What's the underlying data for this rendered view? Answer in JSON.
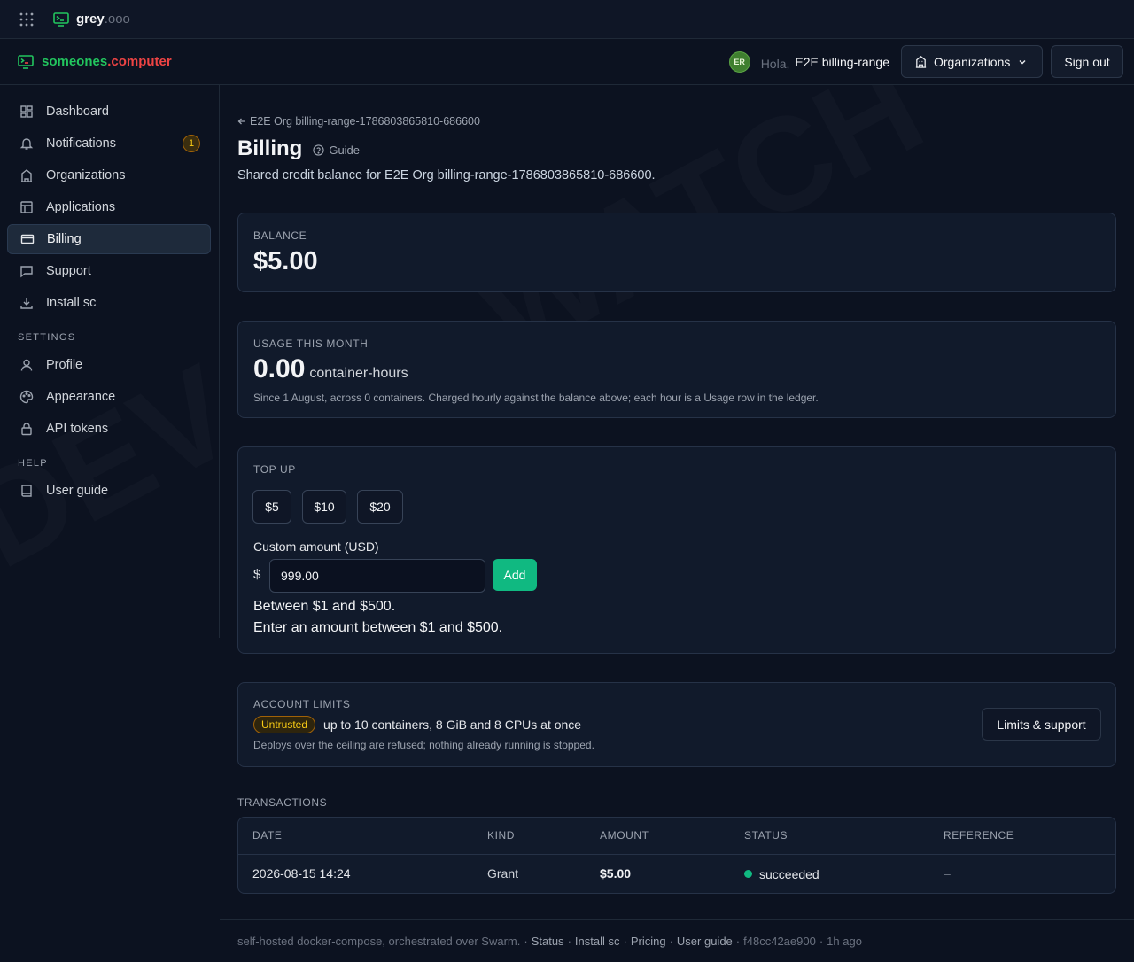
{
  "topbar": {
    "brand_bold": "grey",
    "brand_suffix": ".ooo"
  },
  "header": {
    "brand_part1": "someones",
    "brand_part2": ".computer",
    "avatar_initials": "ER",
    "greeting": "Hola,",
    "user_name": "E2E billing-range",
    "organizations_label": "Organizations",
    "sign_out_label": "Sign out"
  },
  "sidebar": {
    "items": [
      {
        "label": "Dashboard"
      },
      {
        "label": "Notifications",
        "badge": "1"
      },
      {
        "label": "Organizations"
      },
      {
        "label": "Applications"
      },
      {
        "label": "Billing"
      },
      {
        "label": "Support"
      },
      {
        "label": "Install sc"
      }
    ],
    "settings_heading": "SETTINGS",
    "settings_items": [
      {
        "label": "Profile"
      },
      {
        "label": "Appearance"
      },
      {
        "label": "API tokens"
      }
    ],
    "help_heading": "HELP",
    "help_items": [
      {
        "label": "User guide"
      }
    ]
  },
  "page": {
    "back_link": "E2E Org billing-range-1786803865810-686600",
    "title": "Billing",
    "guide_label": "Guide",
    "subtitle": "Shared credit balance for E2E Org billing-range-1786803865810-686600."
  },
  "balance": {
    "label": "BALANCE",
    "value": "$5.00"
  },
  "usage": {
    "label": "USAGE THIS MONTH",
    "value": "0.00",
    "unit": "container-hours",
    "note": "Since 1 August, across 0 containers. Charged hourly against the balance above; each hour is a Usage row in the ledger."
  },
  "topup": {
    "label": "TOP UP",
    "amounts": [
      "$5",
      "$10",
      "$20"
    ],
    "custom_label": "Custom amount (USD)",
    "currency_symbol": "$",
    "custom_value": "999.00",
    "add_label": "Add",
    "hint": "Between $1 and $500.",
    "error": "Enter an amount between $1 and $500."
  },
  "limits": {
    "label": "ACCOUNT LIMITS",
    "tier": "Untrusted",
    "summary": "up to 10 containers, 8 GiB and 8 CPUs at once",
    "note": "Deploys over the ceiling are refused; nothing already running is stopped.",
    "button_label": "Limits & support"
  },
  "transactions": {
    "label": "TRANSACTIONS",
    "columns": [
      "DATE",
      "KIND",
      "AMOUNT",
      "STATUS",
      "REFERENCE"
    ],
    "rows": [
      {
        "date": "2026-08-15 14:24",
        "kind": "Grant",
        "amount": "$5.00",
        "status": "succeeded",
        "reference": "–"
      }
    ]
  },
  "footer": {
    "text": "self-hosted docker-compose, orchestrated over Swarm.",
    "sep": "·",
    "links": [
      "Status",
      "Install sc",
      "Pricing",
      "User guide"
    ],
    "commit": "f48cc42ae900",
    "age": "1h ago"
  },
  "colors": {
    "accent_green": "#10b981",
    "brand_red": "#ef4444",
    "warning_yellow": "#facc15",
    "background": "#0c1220"
  }
}
